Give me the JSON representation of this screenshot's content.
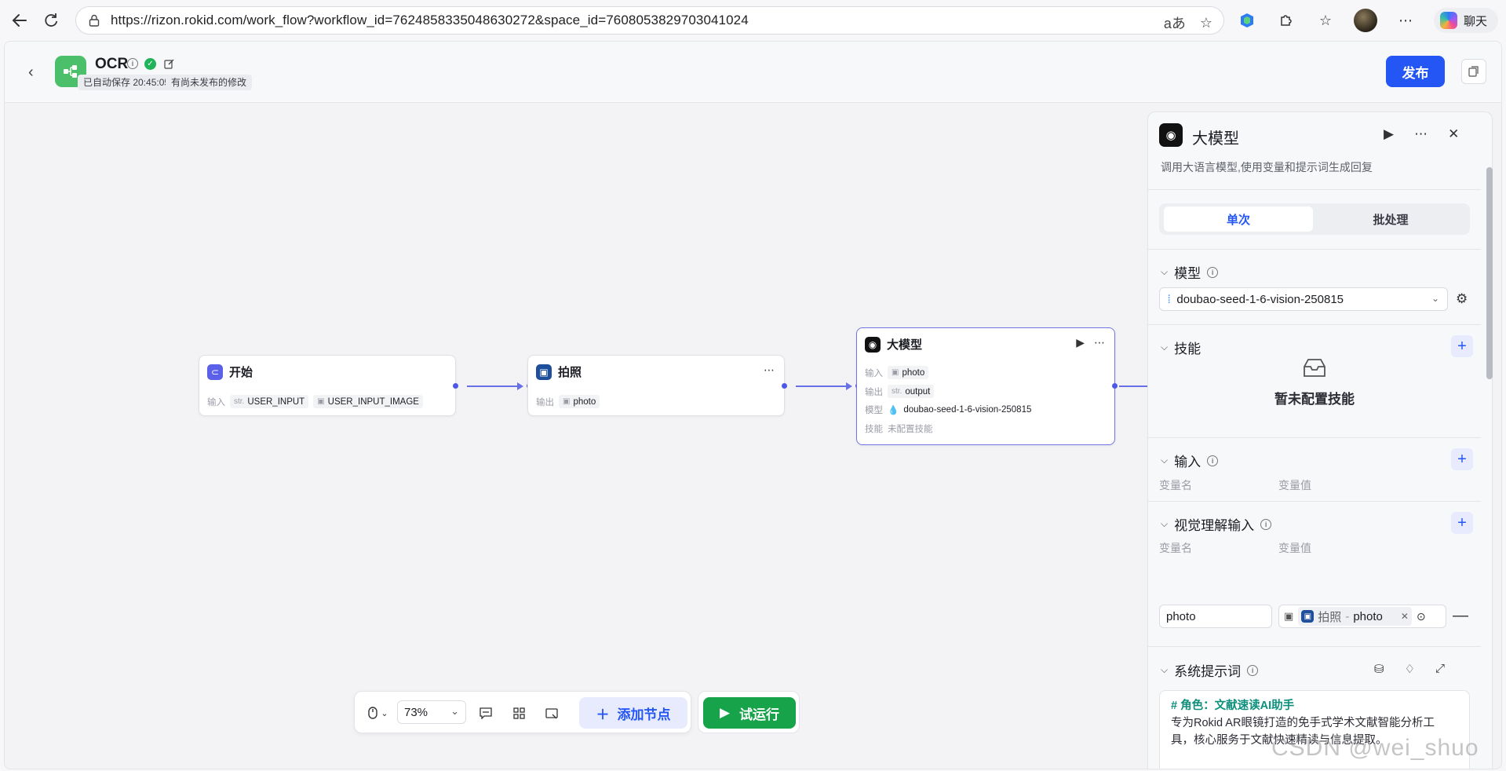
{
  "browser": {
    "url": "https://rizon.rokid.com/work_flow?workflow_id=7624858335048630272&space_id=7608053829703041024",
    "chat_label": "聊天"
  },
  "header": {
    "title": "OCR",
    "autosave_tag": "已自动保存 20:45:05",
    "unpublished_tag": "有尚未发布的修改",
    "publish_label": "发布"
  },
  "nodes": {
    "start": {
      "title": "开始",
      "input_label": "输入",
      "inputs": [
        {
          "prefix": "str.",
          "name": "USER_INPUT"
        },
        {
          "prefix": "img",
          "name": "USER_INPUT_IMAGE"
        }
      ]
    },
    "photo": {
      "title": "拍照",
      "output_label": "输出",
      "output": "photo"
    },
    "llm": {
      "title": "大模型",
      "input_label": "输入",
      "input": "photo",
      "output_label": "输出",
      "output_prefix": "str.",
      "output": "output",
      "model_label": "模型",
      "model": "doubao-seed-1-6-vision-250815",
      "skill_label": "技能",
      "skill_value": "未配置技能"
    }
  },
  "toolbar": {
    "zoom": "73%",
    "add_node_label": "添加节点",
    "run_label": "试运行"
  },
  "panel": {
    "title": "大模型",
    "description": "调用大语言模型,使用变量和提示词生成回复",
    "tabs": [
      "单次",
      "批处理"
    ],
    "model_section": "模型",
    "model_value": "doubao-seed-1-6-vision-250815",
    "skill_section": "技能",
    "skill_empty": "暂未配置技能",
    "input_section": "输入",
    "var_name_label": "变量名",
    "var_value_label": "变量值",
    "vision_section": "视觉理解输入",
    "vision_var_name": "photo",
    "vision_ref_node": "拍照",
    "vision_ref_sep": " - ",
    "vision_ref_var": "photo",
    "system_prompt_section": "系统提示词",
    "prompt_heading": "# 角色：文献速读AI助手",
    "prompt_line1": "专为Rokid AR眼镜打造的免手式学术文献智能分析工",
    "prompt_line2": "具，核心服务于文献快速精读与信息提取。"
  },
  "watermark": "CSDN @wei_shuo",
  "colors": {
    "accent": "#2456f5",
    "run_green": "#16a34a",
    "edge": "#6870e8",
    "prompt_heading": "#0d8f7c"
  }
}
